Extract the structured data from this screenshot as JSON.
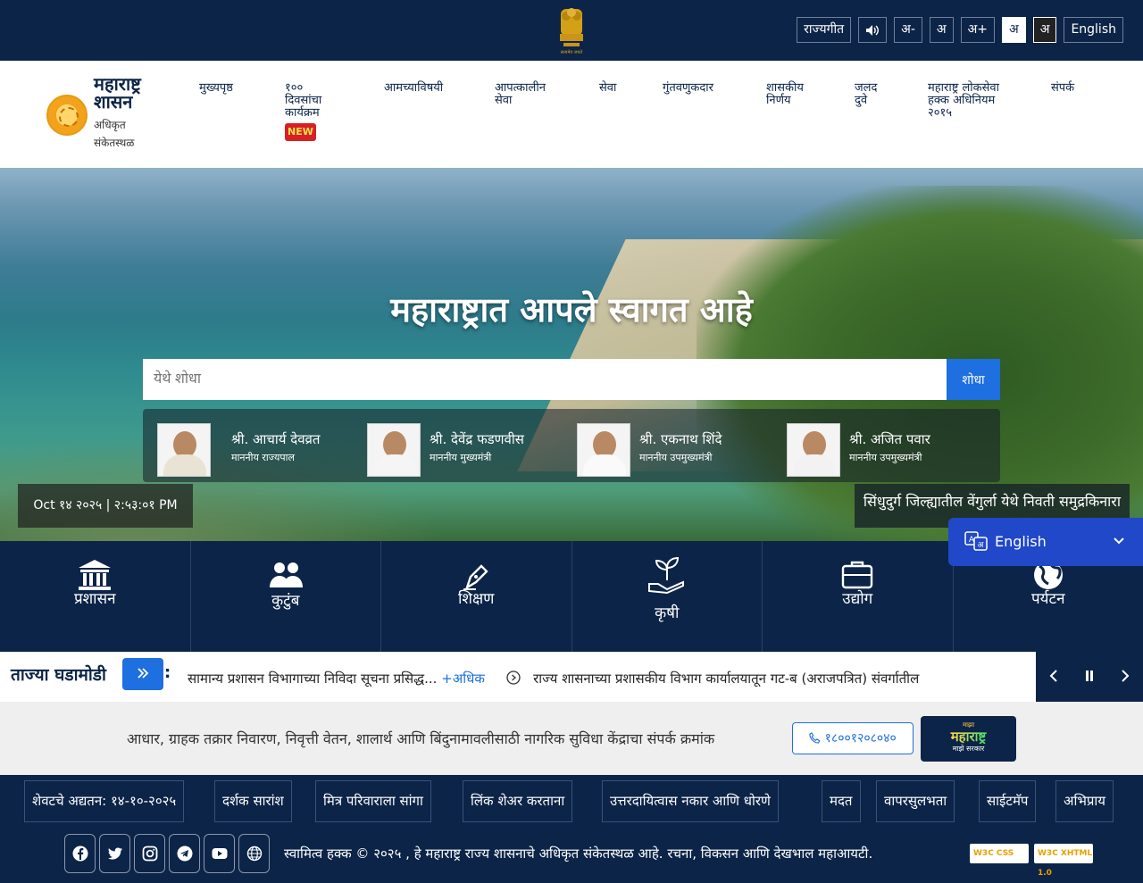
{
  "topbar": {
    "anthem": "राज्यगीत",
    "font_minus": "अ-",
    "font_normal": "अ",
    "font_plus": "अ+",
    "contrast_light": "अ",
    "contrast_dark": "अ",
    "english": "English",
    "speaker_icon": "speaker-icon",
    "emblem_caption": "सत्यमेव जयते"
  },
  "brand": {
    "title": "महाराष्ट्र शासन",
    "subtitle": "अधिकृत संकेतस्थळ"
  },
  "nav": {
    "items": [
      {
        "label": "मुख्यपृष्ठ"
      },
      {
        "label": "१०० दिवसांचा कार्यक्रम",
        "badge": "NEW"
      },
      {
        "label": "आमच्याविषयी"
      },
      {
        "label": "आपत्कालीन सेवा"
      },
      {
        "label": "सेवा"
      },
      {
        "label": "गुंतवणुकदार"
      },
      {
        "label": "शासकीय निर्णय"
      },
      {
        "label": "जलद दुवे"
      },
      {
        "label": "महाराष्ट्र लोकसेवा हक्क अधिनियम २०१५"
      },
      {
        "label": "संपर्क"
      }
    ]
  },
  "hero": {
    "welcome": "महाराष्ट्रात आपले स्वागत आहे",
    "search_placeholder": "येथे शोधा",
    "search_button": "शोधा",
    "leaders": [
      {
        "name": "श्री. आचार्य देवव्रत",
        "role": "माननीय राज्यपाल"
      },
      {
        "name": "श्री. देवेंद्र फडणवीस",
        "role": "माननीय मुख्यमंत्री"
      },
      {
        "name": "श्री. एकनाथ शिंदे",
        "role": "माननीय उपमुख्यमंत्री"
      },
      {
        "name": "श्री. अजित पवार",
        "role": "माननीय उपमुख्यमंत्री"
      }
    ],
    "datetime": "Oct १४ २०२५ | २:५३:०१ PM",
    "caption": "सिंधुदुर्ग जिल्ह्यातील वेंगुर्ला येथे निवती समुद्रकिनारा"
  },
  "language_selector": {
    "selected": "English"
  },
  "categories": [
    {
      "label": "प्रशासन",
      "icon": "building-icon"
    },
    {
      "label": "कुटुंब",
      "icon": "family-icon"
    },
    {
      "label": "शिक्षण",
      "icon": "pen-icon"
    },
    {
      "label": "कृषी",
      "icon": "plant-icon"
    },
    {
      "label": "उद्योग",
      "icon": "briefcase-icon"
    },
    {
      "label": "पर्यटन",
      "icon": "globe-icon"
    }
  ],
  "news": {
    "title": "ताज्या घडामोडी",
    "item1": "सामान्य प्रशासन विभागाच्या निविदा सूचना प्रसिद्ध...",
    "more": "+अधिक",
    "item2": "राज्य शासनाच्या प्रशासकीय विभाग कार्यालयातून गट-ब (अराजपत्रित) संवर्गातील"
  },
  "helpline": {
    "text": "आधार, ग्राहक तक्रार निवारण, निवृत्ती वेतन, शालार्थ आणि बिंदुनामावलीसाठी नागरिक सुविधा केंद्राचा संपर्क क्रमांक",
    "phone": "१८००१२०८०४०",
    "logo_top": "माझा",
    "logo_main": "महाराष्ट्र",
    "logo_bottom": "माझे सरकार"
  },
  "footer_links": [
    "शेवटचे अद्यतन: १४-१०-२०२५",
    "दर्शक सारांश",
    "मित्र परिवाराला सांगा",
    "लिंक शेअर करताना",
    "उत्तरदायित्वास नकार आणि धोरणे",
    "मदत",
    "वापरसुलभता",
    "साईटमॅप",
    "अभिप्राय"
  ],
  "copyright": {
    "text": "स्वामित्व हक्क © २०२५ , हे महाराष्ट्र राज्य शासनाचे अधिकृत संकेतस्थळ आहे. रचना, विकसन आणि देखभाल महाआयटी.",
    "badge_css": "W3C CSS",
    "badge_xhtml": "W3C XHTML 1.0",
    "social": [
      "facebook-icon",
      "twitter-icon",
      "instagram-icon",
      "telegram-icon",
      "youtube-icon",
      "globe-icon"
    ]
  },
  "colors": {
    "navy": "#0c2447",
    "accent_blue": "#1e6fe0",
    "badge_red": "#d81f26"
  }
}
